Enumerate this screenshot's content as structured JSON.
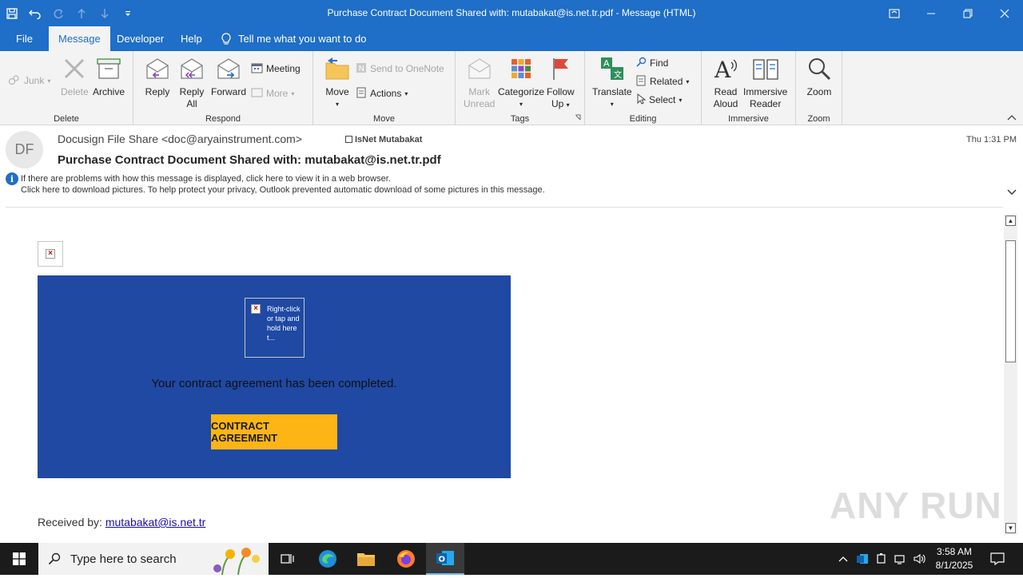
{
  "window": {
    "title": "Purchase Contract Document Shared with: mutabakat@is.net.tr.pdf  -  Message (HTML)"
  },
  "menu": {
    "tabs": [
      "File",
      "Message",
      "Developer",
      "Help"
    ],
    "active": "Message",
    "tell_me": "Tell me what you want to do"
  },
  "ribbon": {
    "delete_group": {
      "label": "Delete",
      "junk": "Junk",
      "delete": "Delete",
      "archive": "Archive"
    },
    "respond_group": {
      "label": "Respond",
      "reply": "Reply",
      "reply_all_1": "Reply",
      "reply_all_2": "All",
      "forward": "Forward",
      "meeting": "Meeting",
      "more": "More"
    },
    "move_group": {
      "label": "Move",
      "move": "Move",
      "send_onenote": "Send to OneNote",
      "actions": "Actions"
    },
    "tags_group": {
      "label": "Tags",
      "mark_1": "Mark",
      "mark_2": "Unread",
      "categorize": "Categorize",
      "follow_1": "Follow",
      "follow_2": "Up"
    },
    "editing_group": {
      "label": "Editing",
      "translate": "Translate",
      "find": "Find",
      "related": "Related",
      "select": "Select"
    },
    "immersive_group": {
      "label": "Immersive",
      "read_1": "Read",
      "read_2": "Aloud",
      "reader_1": "Immersive",
      "reader_2": "Reader"
    },
    "zoom_group": {
      "label": "Zoom",
      "zoom": "Zoom"
    }
  },
  "message": {
    "avatar_initials": "DF",
    "from": "Docusign File Share <doc@aryainstrument.com>",
    "to": "IsNet Mutabakat",
    "subject": "Purchase Contract Document Shared with: mutabakat@is.net.tr.pdf",
    "date": "Thu 1:31 PM",
    "info_line_1": "If there are problems with how this message is displayed, click here to view it in a web browser.",
    "info_line_2": "Click here to download pictures. To help protect your privacy, Outlook prevented automatic download of some pictures in this message."
  },
  "body": {
    "placeholder_text": "Right-click or tap and hold here t...",
    "banner_text": "Your contract agreement has been completed.",
    "cta_label": "CONTRACT AGREEMENT",
    "received_label": "Received by: ",
    "received_email": "mutabakat@is.net.tr",
    "banner_color": "#1f49a3",
    "cta_color": "#fdb515"
  },
  "watermark": "ANY RUN",
  "taskbar": {
    "search_placeholder": "Type here to search",
    "time": "3:58 AM",
    "date": "8/1/2025"
  }
}
